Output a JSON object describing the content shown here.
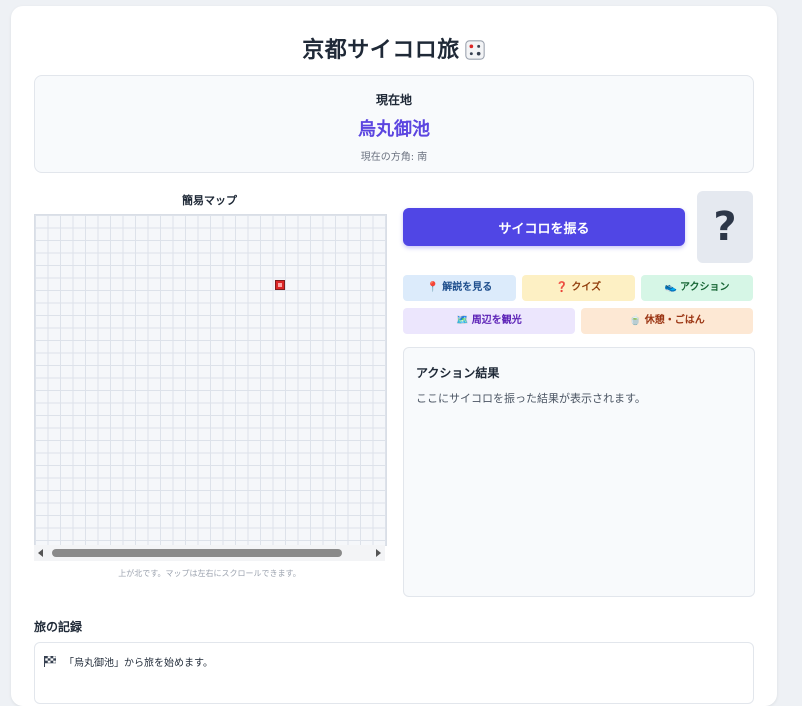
{
  "app": {
    "title": "京都サイコロ旅"
  },
  "location": {
    "label": "現在地",
    "name": "烏丸御池",
    "direction": "現在の方角: 南"
  },
  "map": {
    "title": "簡易マップ",
    "caption": "上が北です。マップは左右にスクロールできます。"
  },
  "controls": {
    "roll_label": "サイコロを振る",
    "dice_value": "?",
    "explain_label": "解説を見る",
    "quiz_label": "クイズ",
    "action_label": "アクション",
    "sightsee_label": "周辺を観光",
    "rest_label": "休憩・ごはん"
  },
  "result": {
    "title": "アクション結果",
    "text": "ここにサイコロを振った結果が表示されます。"
  },
  "log": {
    "title": "旅の記録",
    "entries": [
      "「烏丸御池」から旅を始めます。"
    ]
  },
  "icons": {
    "explain": "pin-icon",
    "quiz": "question-icon",
    "action": "shoe-icon",
    "sightsee": "map-icon",
    "rest": "tea-icon",
    "title": "dice-icon",
    "log": "checkered-flag-icon"
  },
  "colors": {
    "accent": "#5046e5",
    "location_name": "#5b45e0",
    "marker": "#dc2626"
  }
}
